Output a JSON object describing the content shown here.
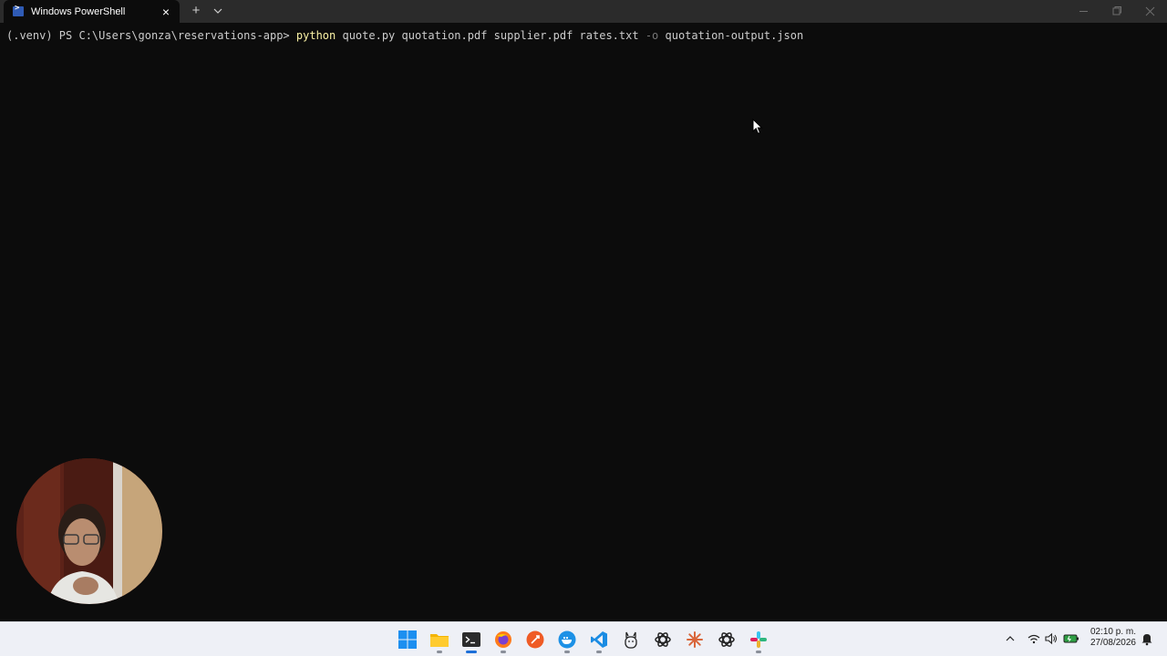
{
  "window": {
    "tab_title": "Windows PowerShell",
    "tab_close_glyph": "×",
    "new_tab_glyph": "+"
  },
  "terminal": {
    "prompt": "(.venv) PS C:\\Users\\gonza\\reservations-app> ",
    "command": "python",
    "args1": " quote.py quotation.pdf supplier.pdf rates.txt ",
    "flag": "-o",
    "args2": " quotation-output.json"
  },
  "taskbar": {
    "apps": [
      "windows-start-icon",
      "file-explorer-icon",
      "terminal-icon",
      "firefox-icon",
      "postman-icon",
      "docker-icon",
      "vscode-icon",
      "ollama-icon",
      "chatgpt-icon",
      "claude-icon",
      "chatgpt-icon",
      "slack-icon"
    ]
  },
  "clock": {
    "time": "02:10 p. m.",
    "date": "27/08/2026"
  },
  "colors": {
    "terminal_bg": "#0c0c0c",
    "titlebar_bg": "#2b2b2b",
    "command_yellow": "#f9f1a5",
    "flag_gray": "#767676",
    "taskbar_bg": "#eef0f6"
  }
}
